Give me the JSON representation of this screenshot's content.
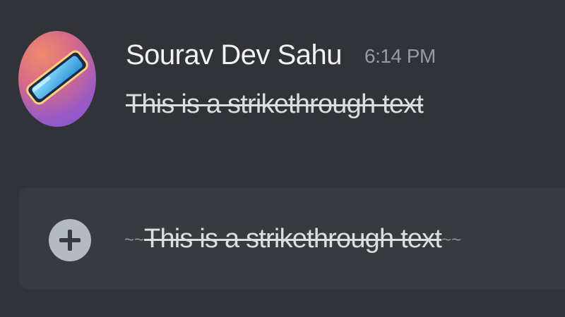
{
  "message": {
    "author": "Sourav Dev Sahu",
    "timestamp": "6:14 PM",
    "text": "This is a strikethrough text",
    "avatar_icon": "phone-icon"
  },
  "composer": {
    "add_icon": "plus-icon",
    "prefix_marker": "~~",
    "text": "This is a strikethrough text",
    "suffix_marker": "~~"
  },
  "colors": {
    "background": "#313338",
    "composer_background": "#383a40",
    "author": "#f2f3f5",
    "timestamp": "#949ba4",
    "text": "#dbdee1",
    "add_button": "#b5bac1"
  }
}
